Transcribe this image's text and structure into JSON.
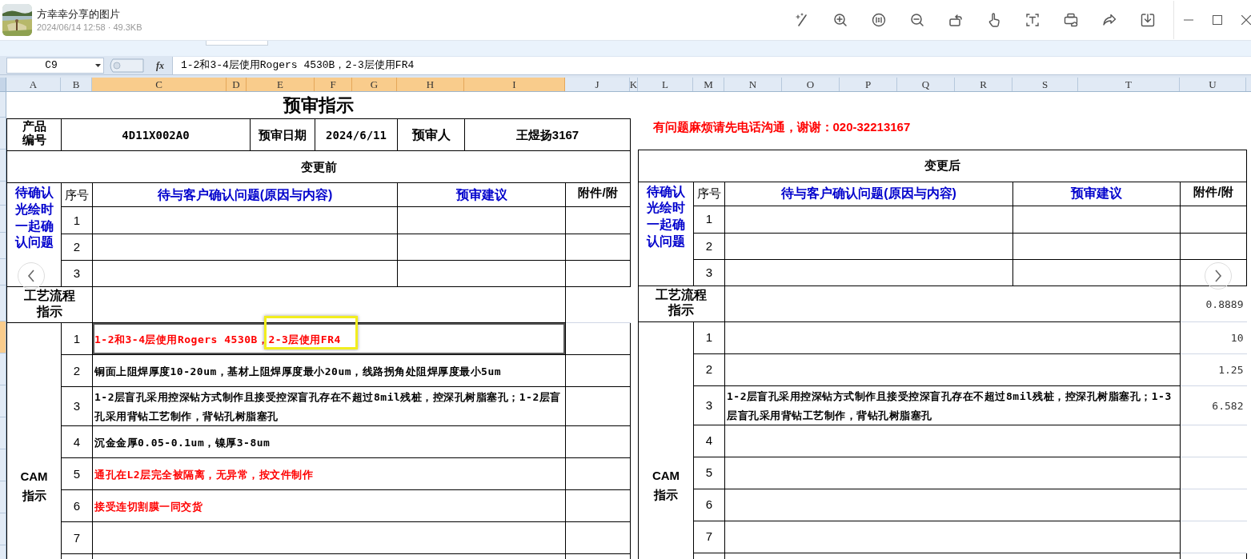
{
  "viewer": {
    "title": "方幸幸分享的图片",
    "subtitle": "2024/06/14 12:58 · 49.3KB"
  },
  "formula_bar": {
    "cell_ref": "C9",
    "function_label": "fx",
    "formula": "1-2和3-4层使用Rogers 4530B，2-3层使用FR4"
  },
  "columns": [
    {
      "label": "A",
      "selected": false
    },
    {
      "label": "B",
      "selected": false
    },
    {
      "label": "C",
      "selected": true
    },
    {
      "label": "D",
      "selected": true
    },
    {
      "label": "E",
      "selected": true
    },
    {
      "label": "F",
      "selected": true
    },
    {
      "label": "G",
      "selected": true
    },
    {
      "label": "H",
      "selected": true
    },
    {
      "label": "I",
      "selected": true
    },
    {
      "label": "J",
      "selected": false
    },
    {
      "label": "K",
      "selected": false
    },
    {
      "label": "L",
      "selected": false
    },
    {
      "label": "M",
      "selected": false
    },
    {
      "label": "N",
      "selected": false
    },
    {
      "label": "O",
      "selected": false
    },
    {
      "label": "P",
      "selected": false
    },
    {
      "label": "Q",
      "selected": false
    },
    {
      "label": "R",
      "selected": false
    },
    {
      "label": "S",
      "selected": false
    },
    {
      "label": "T",
      "selected": false
    },
    {
      "label": "U",
      "selected": false
    }
  ],
  "sheet": {
    "title": "预审指示",
    "notice": "有问题麻烦请先电话沟通，谢谢：020-32213167",
    "product_label": "产品编号",
    "product_code": "4D11X002A0",
    "date_label": "预审日期",
    "date": "2024/6/11",
    "reviewer_label": "预审人",
    "reviewer": "王煜扬3167"
  },
  "before": {
    "heading": "变更前",
    "group_label": "待确认光绘时一起确认问题",
    "headers": [
      "序号",
      "待与客户确认问题(原因与内容)",
      "预审建议",
      "附件/附"
    ],
    "questions": [
      "1",
      "2",
      "3"
    ],
    "process_label": "工艺流程指示",
    "cam_label": "CAM\n指示",
    "cam_rows": [
      {
        "no": "1",
        "text": "1-2和3-4层使用Rogers 4530B，2-3层使用FR4",
        "color": "#ff0000",
        "selected": true
      },
      {
        "no": "2",
        "text": "铜面上阻焊厚度10-20um，基材上阻焊厚度最小20um，线路拐角处阻焊厚度最小5um",
        "color": "#000000",
        "selected": false
      },
      {
        "no": "3",
        "text": "1-2层盲孔采用控深钻方式制作且接受控深盲孔存在不超过8mil残桩，控深孔树脂塞孔；1-2层盲孔采用背钻工艺制作，背钻孔树脂塞孔",
        "color": "#000000",
        "selected": false
      },
      {
        "no": "4",
        "text": "沉金金厚0.05-0.1um，镍厚3-8um",
        "color": "#000000",
        "selected": false
      },
      {
        "no": "5",
        "text": "通孔在L2层完全被隔离，无异常，按文件制作",
        "color": "#ff0000",
        "selected": false
      },
      {
        "no": "6",
        "text": "接受连切割膜一同交货",
        "color": "#ff0000",
        "selected": false
      },
      {
        "no": "7",
        "selected": false
      }
    ]
  },
  "after": {
    "heading": "变更后",
    "group_label": "待确认光绘时一起确认问题",
    "headers": [
      "序号",
      "待与客户确认问题(原因与内容)",
      "预审建议",
      "附件/附"
    ],
    "questions": [
      "1",
      "2",
      "3"
    ],
    "process_label": "工艺流程指示",
    "process_value": "0.8889",
    "cam_label": "CAM\n指示",
    "cam_rows": [
      {
        "no": "1",
        "value": "10"
      },
      {
        "no": "2",
        "value": "1.25"
      },
      {
        "no": "3",
        "text": "1-2层盲孔采用控深钻方式制作且接受控深盲孔存在不超过8mil残桩，控深孔树脂塞孔；1-3层盲孔采用背钻工艺制作，背钻孔树脂塞孔",
        "value": "6.582"
      },
      {
        "no": "4"
      },
      {
        "no": "5"
      },
      {
        "no": "6"
      },
      {
        "no": "7"
      }
    ]
  }
}
